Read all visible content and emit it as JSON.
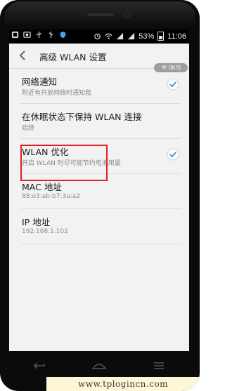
{
  "status_bar": {
    "battery_percent": "53%",
    "time": "11:06",
    "icons": [
      "notification-icon",
      "image-icon",
      "usb-icon",
      "usb-debug-icon",
      "shield-icon",
      "alarm-icon",
      "wifi-icon",
      "signal-icon",
      "signal-icon",
      "battery-icon"
    ]
  },
  "action_bar": {
    "title": "高级 WLAN 设置",
    "speed": "0K/S"
  },
  "settings": [
    {
      "label": "网络通知",
      "sub": "附近有开放网络时通知我",
      "checked": true
    },
    {
      "label": "在休眠状态下保持 WLAN 连接",
      "sub": "始终",
      "checked": false
    },
    {
      "label": "WLAN 优化",
      "sub": "开启 WLAN 时尽可能节约电池用量",
      "checked": true
    },
    {
      "label": "MAC 地址",
      "sub": "88:e3:ab:b7:3a:a2",
      "checked": false
    },
    {
      "label": "IP 地址",
      "sub": "192.168.1.102",
      "checked": false
    }
  ],
  "watermark": "www.tplogincn.com",
  "colors": {
    "highlight": "#e0202a",
    "check": "#3a8fd6"
  }
}
